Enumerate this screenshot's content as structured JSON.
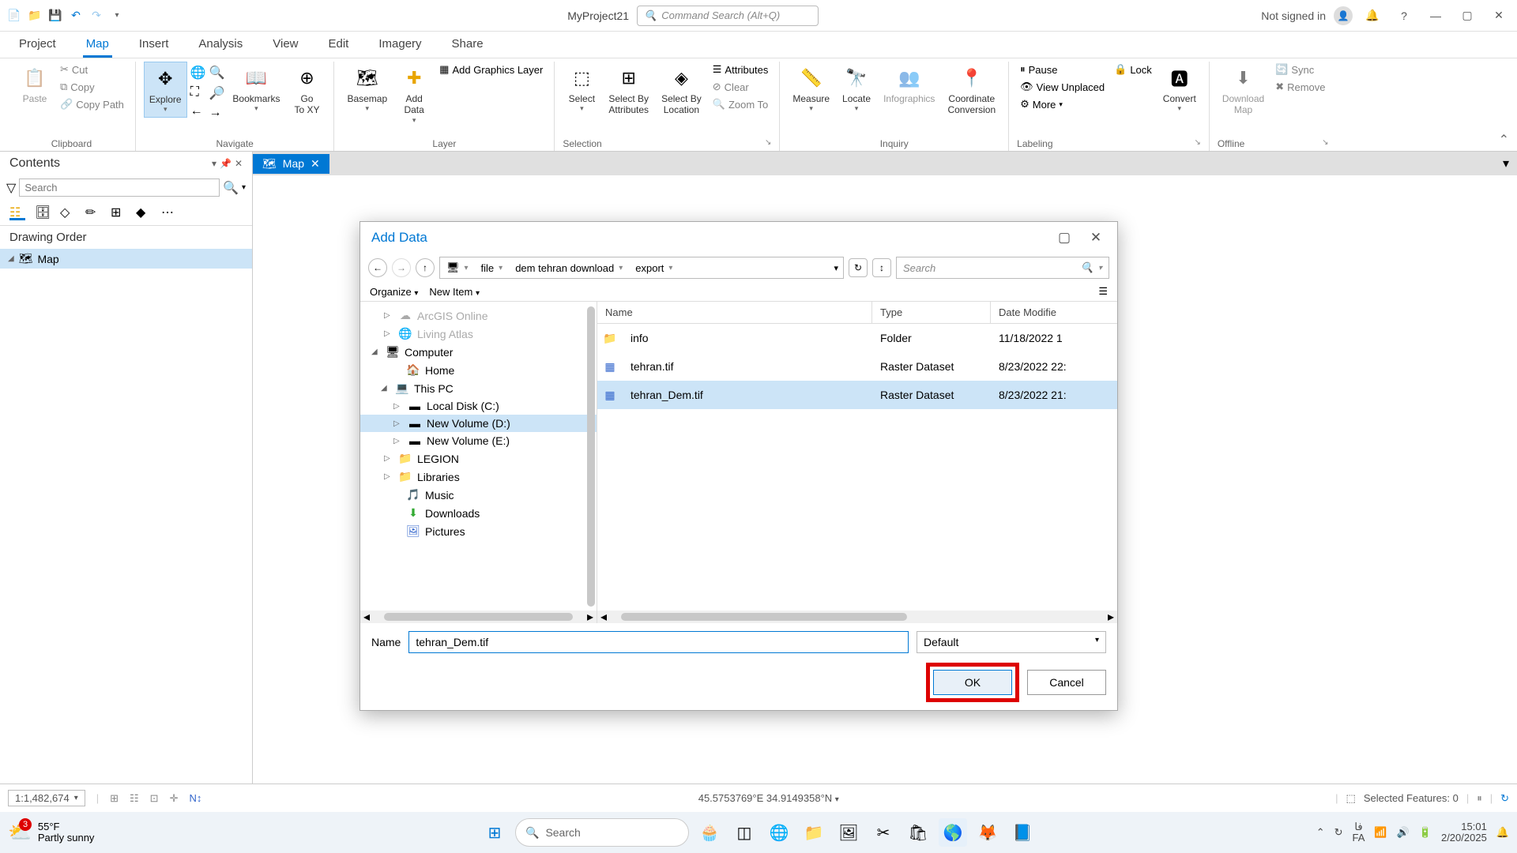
{
  "titlebar": {
    "project": "MyProject21",
    "search_placeholder": "Command Search (Alt+Q)",
    "signin": "Not signed in"
  },
  "tabs": {
    "project": "Project",
    "map": "Map",
    "insert": "Insert",
    "analysis": "Analysis",
    "view": "View",
    "edit": "Edit",
    "imagery": "Imagery",
    "share": "Share"
  },
  "ribbon": {
    "clipboard": {
      "label": "Clipboard",
      "paste": "Paste",
      "cut": "Cut",
      "copy": "Copy",
      "copypath": "Copy Path"
    },
    "navigate": {
      "label": "Navigate",
      "explore": "Explore",
      "bookmarks": "Bookmarks",
      "goto": "Go\nTo XY"
    },
    "layer": {
      "label": "Layer",
      "basemap": "Basemap",
      "adddata": "Add\nData",
      "addgraphics": "Add Graphics Layer"
    },
    "selection": {
      "label": "Selection",
      "select": "Select",
      "byattr": "Select By\nAttributes",
      "byloc": "Select By\nLocation",
      "attributes": "Attributes",
      "clear": "Clear",
      "zoomto": "Zoom To"
    },
    "inquiry": {
      "label": "Inquiry",
      "measure": "Measure",
      "locate": "Locate",
      "infographics": "Infographics",
      "coord": "Coordinate\nConversion"
    },
    "labeling": {
      "label": "Labeling",
      "pause": "Pause",
      "lock": "Lock",
      "viewunplaced": "View Unplaced",
      "more": "More",
      "convert": "Convert"
    },
    "offline": {
      "label": "Offline",
      "download": "Download\nMap",
      "sync": "Sync",
      "remove": "Remove"
    }
  },
  "contents": {
    "title": "Contents",
    "search_placeholder": "Search",
    "drawing_order": "Drawing Order",
    "map_item": "Map"
  },
  "maptab": {
    "label": "Map"
  },
  "dialog": {
    "title": "Add Data",
    "breadcrumb": {
      "p1": "file",
      "p2": "dem tehran download",
      "p3": "export"
    },
    "search_placeholder": "Search",
    "toolbar": {
      "organize": "Organize",
      "newitem": "New Item"
    },
    "tree": {
      "arcgis": "ArcGIS Online",
      "livingatlas": "Living Atlas",
      "computer": "Computer",
      "home": "Home",
      "thispc": "This PC",
      "cdrive": "Local Disk (C:)",
      "ddrive": "New Volume (D:)",
      "edrive": "New Volume (E:)",
      "legion": "LEGION",
      "libraries": "Libraries",
      "music": "Music",
      "downloads": "Downloads",
      "pictures": "Pictures"
    },
    "columns": {
      "name": "Name",
      "type": "Type",
      "date": "Date Modifie"
    },
    "rows": [
      {
        "name": "info",
        "type": "Folder",
        "date": "11/18/2022 1"
      },
      {
        "name": "tehran.tif",
        "type": "Raster Dataset",
        "date": "8/23/2022 22:"
      },
      {
        "name": "tehran_Dem.tif",
        "type": "Raster Dataset",
        "date": "8/23/2022 21:"
      }
    ],
    "name_label": "Name",
    "name_value": "tehran_Dem.tif",
    "filter": "Default",
    "ok": "OK",
    "cancel": "Cancel"
  },
  "statusbar": {
    "scale": "1:1,482,674",
    "coords": "45.5753769°E 34.9149358°N",
    "selected": "Selected Features: 0"
  },
  "taskbar": {
    "temp": "55°F",
    "cond": "Partly sunny",
    "badge": "3",
    "search": "Search",
    "lang": "فا",
    "langcode": "FA",
    "time": "15:01",
    "date": "2/20/2025"
  }
}
